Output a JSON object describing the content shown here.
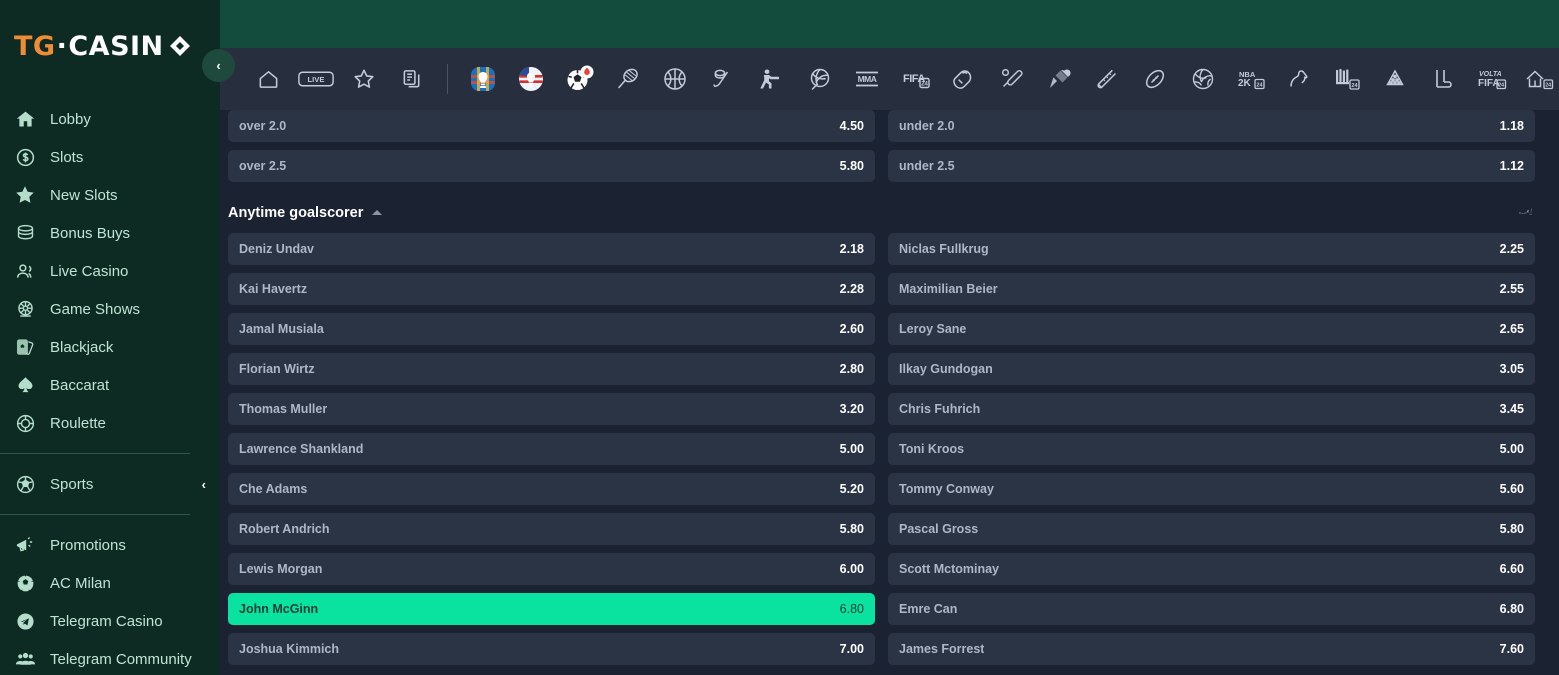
{
  "brand": {
    "logo_tg": "TG",
    "logo_dot": "·",
    "logo_casino": "CASIN",
    "accent_orange": "#f08b36",
    "accent_green": "#0ae3a0",
    "header_green": "#134b3c",
    "sidebar_bg": "#0d2b22",
    "row_bg": "#2b3445",
    "page_bg": "#1b2232"
  },
  "sidebar": {
    "collapse_label": "‹",
    "items": [
      {
        "label": "Lobby",
        "icon": "home-icon"
      },
      {
        "label": "Slots",
        "icon": "coin-dollar-icon"
      },
      {
        "label": "New Slots",
        "icon": "star-icon"
      },
      {
        "label": "Bonus Buys",
        "icon": "coins-stack-icon"
      },
      {
        "label": "Live Casino",
        "icon": "people-icon"
      },
      {
        "label": "Game Shows",
        "icon": "wheel-icon"
      },
      {
        "label": "Blackjack",
        "icon": "cards-icon"
      },
      {
        "label": "Baccarat",
        "icon": "spade-icon"
      },
      {
        "label": "Roulette",
        "icon": "roulette-chip-icon"
      },
      {
        "label": "Sports",
        "icon": "soccer-ball-icon",
        "chevron": "‹"
      },
      {
        "label": "Promotions",
        "icon": "megaphone-icon"
      },
      {
        "label": "AC Milan",
        "icon": "football-icon"
      },
      {
        "label": "Telegram Casino",
        "icon": "telegram-icon"
      },
      {
        "label": "Telegram Community",
        "icon": "community-icon"
      }
    ]
  },
  "topnav": {
    "icons": [
      "home-icon",
      "live-badge-icon",
      "star-icon",
      "bet-slip-icon",
      "divider",
      "euro-trophy-icon",
      "copa-america-icon",
      "football-hot-icon",
      "tennis-icon",
      "basketball-icon",
      "ice-hockey-icon",
      "esports-shooter-icon",
      "volleyball-icon",
      "mma-icon",
      "fifa24-icon",
      "boxing-glove-icon",
      "cricket-icon",
      "badminton-icon",
      "baseball-icon",
      "rugby-icon",
      "handball-icon",
      "nba2k-icon",
      "horse-racing-icon",
      "greyhound-icon",
      "snooker-icon",
      "table-tennis-icon",
      "volta-fifa-icon",
      "futsal-icon",
      "pes-icon"
    ],
    "live_label": "LIVE"
  },
  "markets": {
    "over_under": {
      "left": [
        {
          "name": "over 2.0",
          "odds": "4.50",
          "selected": false
        },
        {
          "name": "over 2.5",
          "odds": "5.80",
          "selected": false
        }
      ],
      "right": [
        {
          "name": "under 2.0",
          "odds": "1.18",
          "selected": false
        },
        {
          "name": "under 2.5",
          "odds": "1.12",
          "selected": false
        }
      ]
    },
    "anytime_goalscorer": {
      "title": "Anytime goalscorer",
      "collapse_caret": "caret-up-icon",
      "pin": "pin-icon",
      "left": [
        {
          "name": "Deniz Undav",
          "odds": "2.18",
          "selected": false
        },
        {
          "name": "Kai Havertz",
          "odds": "2.28",
          "selected": false
        },
        {
          "name": "Jamal Musiala",
          "odds": "2.60",
          "selected": false
        },
        {
          "name": "Florian Wirtz",
          "odds": "2.80",
          "selected": false
        },
        {
          "name": "Thomas Muller",
          "odds": "3.20",
          "selected": false
        },
        {
          "name": "Lawrence Shankland",
          "odds": "5.00",
          "selected": false
        },
        {
          "name": "Che Adams",
          "odds": "5.20",
          "selected": false
        },
        {
          "name": "Robert Andrich",
          "odds": "5.80",
          "selected": false
        },
        {
          "name": "Lewis Morgan",
          "odds": "6.00",
          "selected": false
        },
        {
          "name": "John McGinn",
          "odds": "6.80",
          "selected": true
        },
        {
          "name": "Joshua Kimmich",
          "odds": "7.00",
          "selected": false
        }
      ],
      "right": [
        {
          "name": "Niclas Fullkrug",
          "odds": "2.25",
          "selected": false
        },
        {
          "name": "Maximilian Beier",
          "odds": "2.55",
          "selected": false
        },
        {
          "name": "Leroy Sane",
          "odds": "2.65",
          "selected": false
        },
        {
          "name": "Ilkay Gundogan",
          "odds": "3.05",
          "selected": false
        },
        {
          "name": "Chris Fuhrich",
          "odds": "3.45",
          "selected": false
        },
        {
          "name": "Toni Kroos",
          "odds": "5.00",
          "selected": false
        },
        {
          "name": "Tommy Conway",
          "odds": "5.60",
          "selected": false
        },
        {
          "name": "Pascal Gross",
          "odds": "5.80",
          "selected": false
        },
        {
          "name": "Scott Mctominay",
          "odds": "6.60",
          "selected": false
        },
        {
          "name": "Emre Can",
          "odds": "6.80",
          "selected": false
        },
        {
          "name": "James Forrest",
          "odds": "7.60",
          "selected": false
        }
      ]
    }
  }
}
